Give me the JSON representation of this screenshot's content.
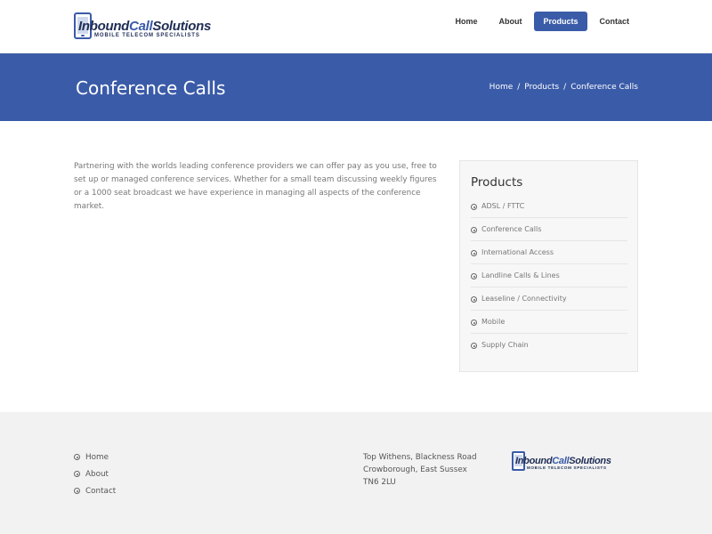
{
  "header": {
    "logo": {
      "brand_part1": "Inbound",
      "brand_part2": "Call",
      "brand_part3": "Solutions",
      "tagline": "MOBILE TELECOM SPECIALISTS"
    },
    "nav": [
      {
        "label": "Home",
        "active": false
      },
      {
        "label": "About",
        "active": false
      },
      {
        "label": "Products",
        "active": true
      },
      {
        "label": "Contact",
        "active": false
      }
    ]
  },
  "banner": {
    "title": "Conference Calls",
    "breadcrumb": [
      "Home",
      "Products",
      "Conference Calls"
    ],
    "breadcrumb_separator": "/"
  },
  "main": {
    "intro": "Partnering with the worlds leading conference providers we can offer pay as you use, free to set up or managed conference services. Whether for a small team discussing weekly figures or a 1000 seat broadcast we have experience in managing all aspects of the conference market."
  },
  "sidebar": {
    "title": "Products",
    "items": [
      "ADSL / FTTC",
      "Conference Calls",
      "International Access",
      "Landline Calls & Lines",
      "Leaseline / Connectivity",
      "Mobile",
      "Supply Chain"
    ]
  },
  "footer": {
    "links": [
      "Home",
      "About",
      "Contact"
    ],
    "address": [
      "Top Withens, Blackness Road",
      "Crowborough, East Sussex",
      "TN6 2LU"
    ],
    "logo": {
      "brand_part1": "Inbound",
      "brand_part2": "Call",
      "brand_part3": "Solutions",
      "tagline": "MOBILE TELECOM SPECIALISTS"
    }
  },
  "colors": {
    "accent": "#3a5ba8",
    "brand_dark": "#1f2d55",
    "footer_bg": "#f2f2f2",
    "sidebar_bg": "#f7f7f7"
  },
  "icons": {
    "list_bullet": "circle-dot-icon",
    "logo_phone": "mobile-phone-icon"
  }
}
